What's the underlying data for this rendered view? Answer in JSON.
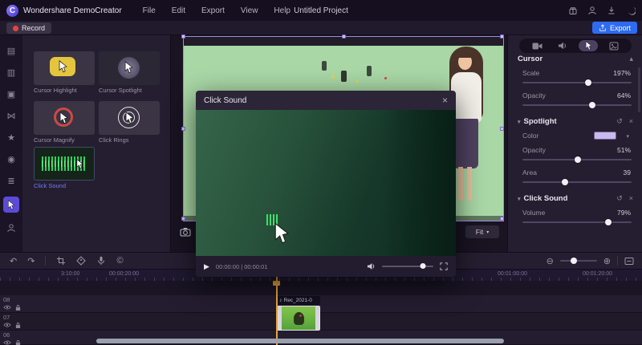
{
  "topbar": {
    "logo_letter": "C",
    "app_name": "Wondershare DemoCreator",
    "menus": [
      "File",
      "Edit",
      "Export",
      "View",
      "Help"
    ],
    "project_title": "Untitled Project"
  },
  "actionbar": {
    "record_label": "Record",
    "export_label": "Export"
  },
  "strip": {
    "glyphs": [
      "▤",
      "▥",
      "▣",
      "⋈",
      "★",
      "◉",
      "≣"
    ]
  },
  "library": {
    "items": [
      {
        "label": "Cursor Highlight"
      },
      {
        "label": "Cursor Spotlight"
      },
      {
        "label": "Cursor Magnify"
      },
      {
        "label": "Click Rings"
      },
      {
        "label": "Click Sound"
      }
    ]
  },
  "preview": {
    "fit_label": "Fit"
  },
  "modal": {
    "title": "Click Sound",
    "time": "00:00:00 | 00:00:01",
    "volume_pct": 80
  },
  "inspector": {
    "cursor": {
      "title": "Cursor",
      "scale_label": "Scale",
      "scale_value": "197%",
      "scale_pct": 60,
      "opacity_label": "Opacity",
      "opacity_value": "64%",
      "opacity_pct": 64
    },
    "spotlight": {
      "title": "Spotlight",
      "color_label": "Color",
      "color_hex": "#c9b9f1",
      "opacity_label": "Opacity",
      "opacity_value": "51%",
      "opacity_pct": 51,
      "area_label": "Area",
      "area_value": "39",
      "area_pct": 39
    },
    "click_sound": {
      "title": "Click Sound",
      "volume_label": "Volume",
      "volume_value": "79%",
      "volume_pct": 79
    }
  },
  "toolbar": {
    "zoom_pct": 38
  },
  "timeline": {
    "ruler_labels": [
      "3:10:00",
      "00:00:20:00",
      "00:01:00:00",
      "00:01:20:00"
    ],
    "tracks": [
      "08",
      "07",
      "06"
    ],
    "clip_name": "Rec_2021-0"
  },
  "glyphs": {
    "collapse_up": "▴",
    "chevron_down": "▾",
    "reset": "↺",
    "close": "×",
    "undo": "↶",
    "redo": "↷",
    "copyright": "©",
    "zoom_out": "⊖",
    "zoom_in": "⊕",
    "play": "▶",
    "music_note": "♪",
    "section_marker": "▾"
  },
  "colors": {
    "accent_blue": "#2e6bf0",
    "record_red": "#e84343",
    "selection_purple": "#9c8fe0",
    "click_sound_label": "#6f7df5"
  }
}
